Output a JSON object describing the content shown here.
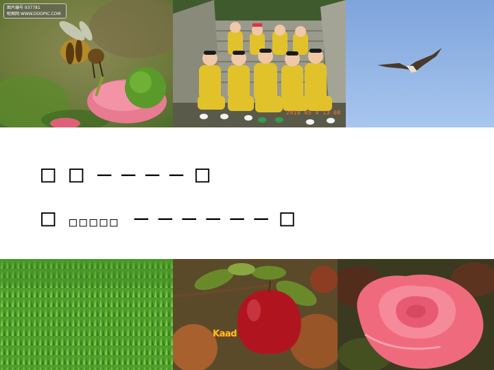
{
  "slide": {
    "line1": {
      "boxes_start": "□ □",
      "dashes": "— — — —",
      "box_end": "□"
    },
    "line2": {
      "box_start": "□",
      "small_boxes": "□□□□□",
      "dashes": "— — — — — —",
      "box_end": "□"
    }
  },
  "photos": {
    "bee": {
      "watermark_line1": "图片编号 937781",
      "watermark_line2": "昵图网 WWW.DOOPIC.COM"
    },
    "kids": {
      "timestamp": "2010 05 4 13 08"
    },
    "apple": {
      "logo_text": "Kaad"
    }
  },
  "colors": {
    "background": "#ffffff",
    "text": "#000000",
    "sky": "#8fb4e8",
    "grass": "#4f9e2c",
    "rose": "#f06a7e",
    "apple": "#b0151f"
  }
}
